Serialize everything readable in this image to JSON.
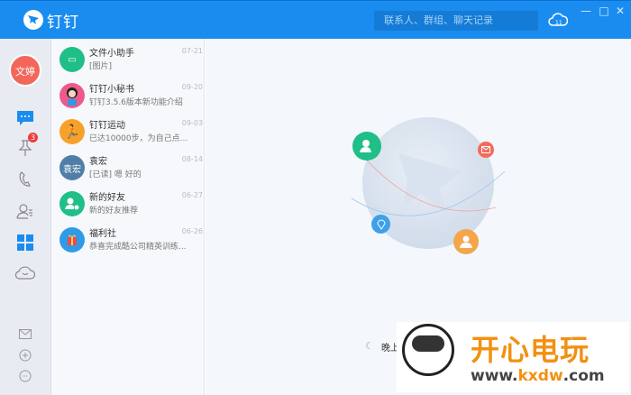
{
  "titlebar": {
    "app_name": "钉钉",
    "search_placeholder": "联系人、群组、聊天记录",
    "cloud_badge": "11"
  },
  "sidebar": {
    "me_avatar": "文婷",
    "pin_badge": "3"
  },
  "conversations": [
    {
      "name": "文件小助手",
      "date": "07-21",
      "preview": "[图片]",
      "avatar_color": "#1fbf87"
    },
    {
      "name": "钉钉小秘书",
      "date": "09-20",
      "preview": "钉钉3.5.6版本新功能介绍",
      "avatar_color": "#ef5a8a"
    },
    {
      "name": "钉钉运动",
      "date": "09-03",
      "preview": "已达10000步，为自己点...",
      "avatar_color": "#f7a12a"
    },
    {
      "name": "袁宏",
      "date": "08-14",
      "preview": "[已读] 嗯 好的",
      "avatar_text": "袁宏",
      "avatar_color": "#4f7fa6"
    },
    {
      "name": "新的好友",
      "date": "06-27",
      "preview": "新的好友推荐",
      "avatar_color": "#1fbf87"
    },
    {
      "name": "福利社",
      "date": "06-26",
      "preview": "恭喜完成酷公司精英训练...",
      "avatar_color": "#2f9be8"
    }
  ],
  "main": {
    "greeting": "晚上"
  },
  "watermark": {
    "title": "开心电玩",
    "url_prefix": "www.",
    "url_domain": "kxdw",
    ".com": ".com",
    "url_suffix": ".com"
  }
}
